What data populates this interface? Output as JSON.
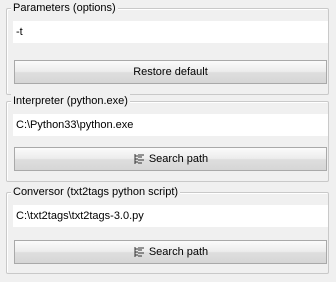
{
  "parameters": {
    "title": "Parameters (options)",
    "value": "-t",
    "button_label": "Restore default"
  },
  "interpreter": {
    "title": "Interpreter (python.exe)",
    "value": "C:\\Python33\\python.exe",
    "button_label": "Search path",
    "button_icon": "tree-icon"
  },
  "conversor": {
    "title": "Conversor (txt2tags python script)",
    "value": "C:\\txt2tags\\txt2tags-3.0.py",
    "button_label": "Search path",
    "button_icon": "tree-icon"
  }
}
